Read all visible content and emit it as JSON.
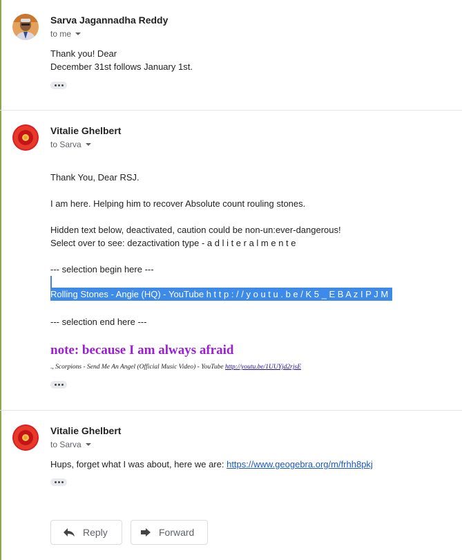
{
  "messages": [
    {
      "sender": "Sarva Jagannadha Reddy",
      "recipient": "to me",
      "body": [
        "Thank you! Dear",
        "December 31st follows January 1st."
      ]
    },
    {
      "sender": "Vitalie Ghelbert",
      "recipient": "to Sarva",
      "body": {
        "greeting": "Thank You, Dear RSJ.",
        "line1": "I am here. Helping him to recover Absolute count rouling stones.",
        "line2": "Hidden text below, deactivated, caution could be non-un:ever-dangerous!",
        "line3": "Select over to see: dezactivation type - a d l i t e r a l m e n t e",
        "sel_begin": "--- selection begin here ---",
        "selected": "Rolling Stones - Angie (HQ) - YouTube h t t p : / / y o u t u . b e / K 5 _ E B A z I P J M",
        "sel_end": "--- selection end here ---",
        "note": "note: because I am always afraid",
        "small_prefix": "., ",
        "small_text": "Scorpions - Send Me An Angel (Official Music Video) - YouTube ",
        "small_link": "http://youtu.be/1UUYjd2rjsE"
      }
    },
    {
      "sender": "Vitalie Ghelbert",
      "recipient": "to Sarva",
      "body_text": "Hups, forget what I was about, here we are: ",
      "body_link": "https://www.geogebra.org/m/frhh8pkj"
    }
  ],
  "actions": {
    "reply": "Reply",
    "forward": "Forward"
  },
  "icons": {
    "expand": "more-dots-icon",
    "reply": "reply-arrow-icon",
    "forward": "forward-arrow-icon",
    "caret": "caret-down-icon"
  }
}
